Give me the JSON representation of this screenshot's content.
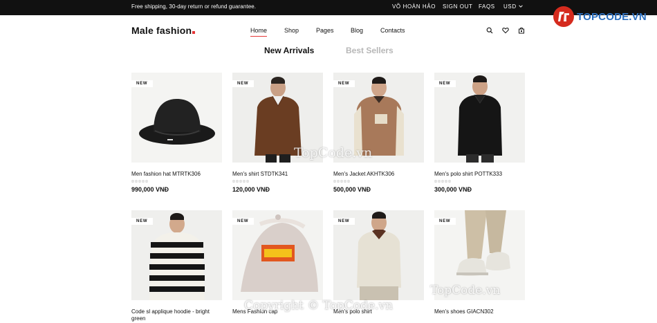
{
  "topbar": {
    "shipping_text": "Free shipping, 30-day return or refund guarantee.",
    "user_name": "VÕ HOÀN HẢO",
    "sign_out": "SIGN OUT",
    "faqs": "FAQS",
    "currency": "USD"
  },
  "watermark": {
    "logo_text": "TOPCODE.VN",
    "mid_text": "TopCode.vn",
    "right_text": "TopCode.vn",
    "copyright_text": "Copyright © TopCode.vn"
  },
  "header": {
    "logo": "Male fashion",
    "nav": [
      {
        "label": "Home",
        "active": true
      },
      {
        "label": "Shop"
      },
      {
        "label": "Pages"
      },
      {
        "label": "Blog"
      },
      {
        "label": "Contacts"
      }
    ],
    "icons": [
      "search-icon",
      "heart-icon",
      "bag-icon"
    ]
  },
  "filters": {
    "new_arrivals": "New Arrivals",
    "best_sellers": "Best Sellers"
  },
  "colors": {
    "accent": "#e53637",
    "topbar": "#111111",
    "inactive_tab": "#b7b7b7"
  },
  "products": [
    {
      "tag": "NEW",
      "name": "Men fashion hat MTRTK306",
      "price": "990,000 VNĐ",
      "rating": 0
    },
    {
      "tag": "NEW",
      "name": "Men's shirt STDTK341",
      "price": "120,000 VNĐ",
      "rating": 0
    },
    {
      "tag": "NEW",
      "name": "Men's Jacket AKHTK306",
      "price": "500,000 VNĐ",
      "rating": 0
    },
    {
      "tag": "NEW",
      "name": "Men's polo shirt POTTK333",
      "price": "300,000 VNĐ",
      "rating": 0
    },
    {
      "tag": "NEW",
      "name": "Code sl applique hoodie - bright green",
      "price": "",
      "rating": 0
    },
    {
      "tag": "NEW",
      "name": "Mens Fashion cap",
      "price": "",
      "rating": 0
    },
    {
      "tag": "NEW",
      "name": "Men's polo shirt",
      "price": "",
      "rating": 0
    },
    {
      "tag": "NEW",
      "name": "Men's shoes GIACN302",
      "price": "",
      "rating": 0
    }
  ]
}
